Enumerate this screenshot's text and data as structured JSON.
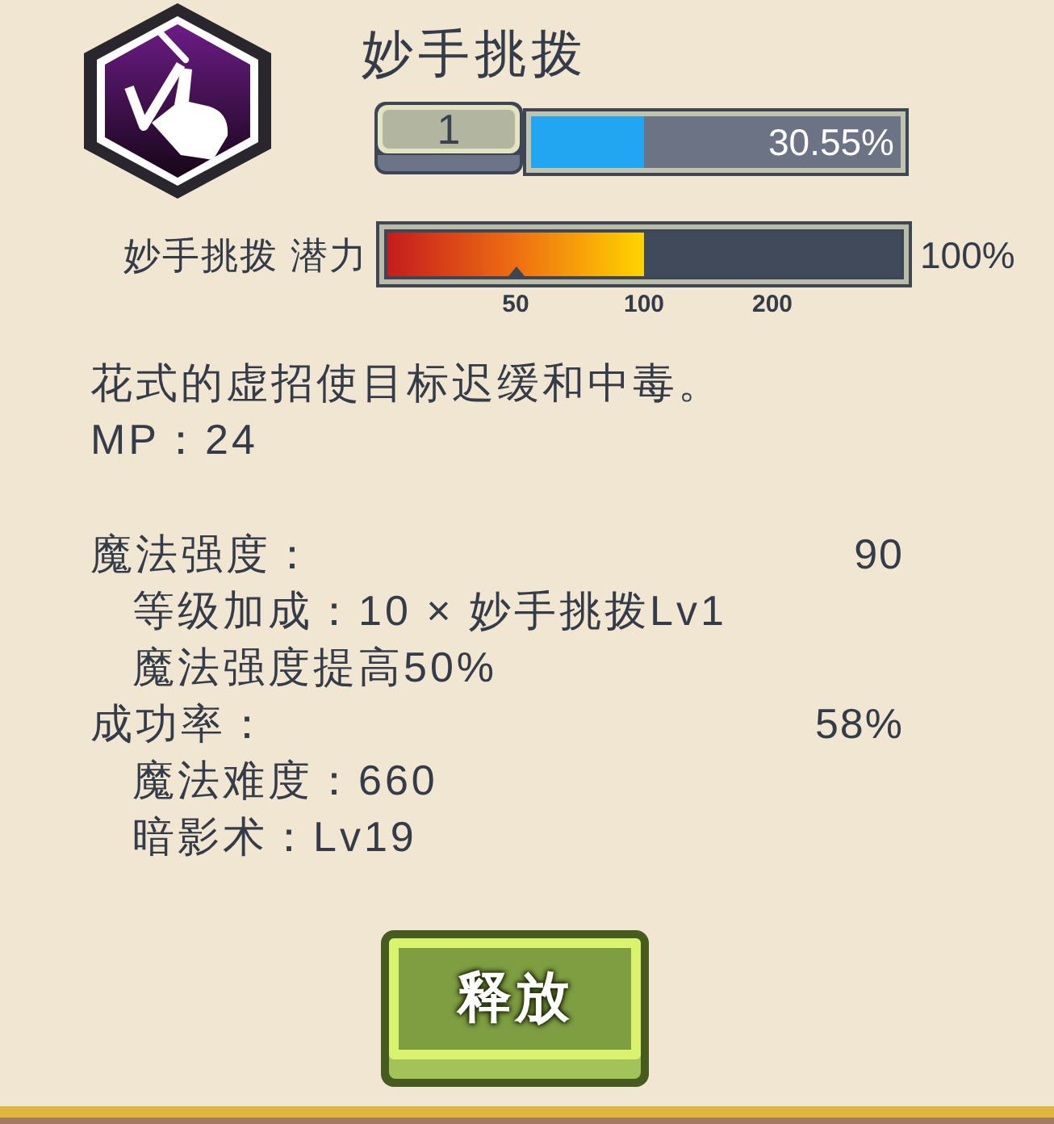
{
  "skill": {
    "name": "妙手挑拨",
    "level_badge": "1",
    "progress": {
      "level": 0.3055,
      "reading": "30.55%"
    }
  },
  "potential": {
    "label": "妙手挑拨 潜力",
    "level": 0.5,
    "reading": "100%",
    "scale_labels": [
      "50",
      "100",
      "200"
    ]
  },
  "description": "花式的虚招使目标迟缓和中毒。",
  "mp": "MP：24",
  "stats": [
    {
      "kind": "header",
      "label": "魔法强度：",
      "value": "90"
    },
    {
      "kind": "detail",
      "text": "等级加成：10 × 妙手挑拨Lv1"
    },
    {
      "kind": "detail",
      "text": "魔法强度提高50%"
    },
    {
      "kind": "header",
      "label": "成功率：",
      "value": "58%"
    },
    {
      "kind": "detail",
      "text": "魔法难度：660"
    },
    {
      "kind": "detail",
      "text": "暗影术：Lv19"
    }
  ],
  "button": {
    "label": "释放"
  }
}
